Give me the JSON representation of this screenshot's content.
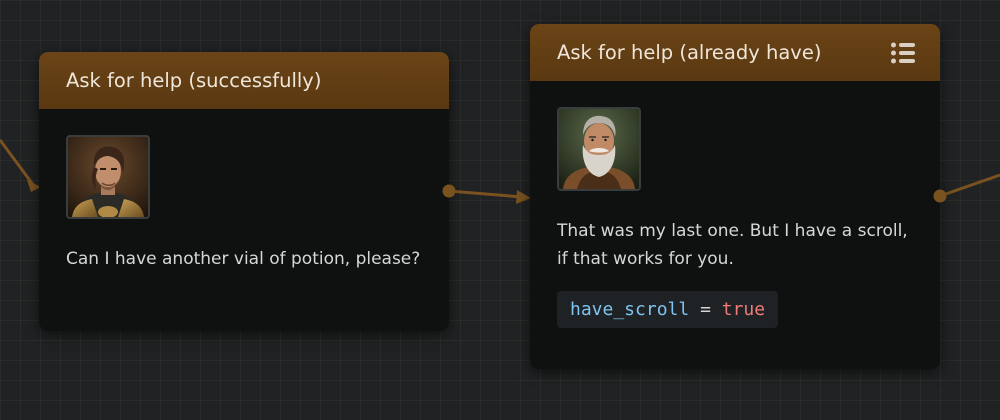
{
  "nodes": [
    {
      "title": "Ask for help (successfully)",
      "portrait": "young-knight-portrait",
      "text": "Can I have another vial of potion, please?"
    },
    {
      "title": "Ask for help (already have)",
      "portrait": "old-bearded-man-portrait",
      "text": "That was my last one. But I have a scroll, if that works for you.",
      "code": {
        "variable": "have_scroll",
        "operator": "=",
        "value": "true"
      },
      "menu_icon": "list-menu-icon"
    }
  ],
  "colors": {
    "canvas": "#202223",
    "node_body": "#0f1111",
    "node_header": "#5f3c13",
    "connector": "#7a5220",
    "code_variable": "#7fc3f0",
    "code_value": "#f07a78"
  }
}
